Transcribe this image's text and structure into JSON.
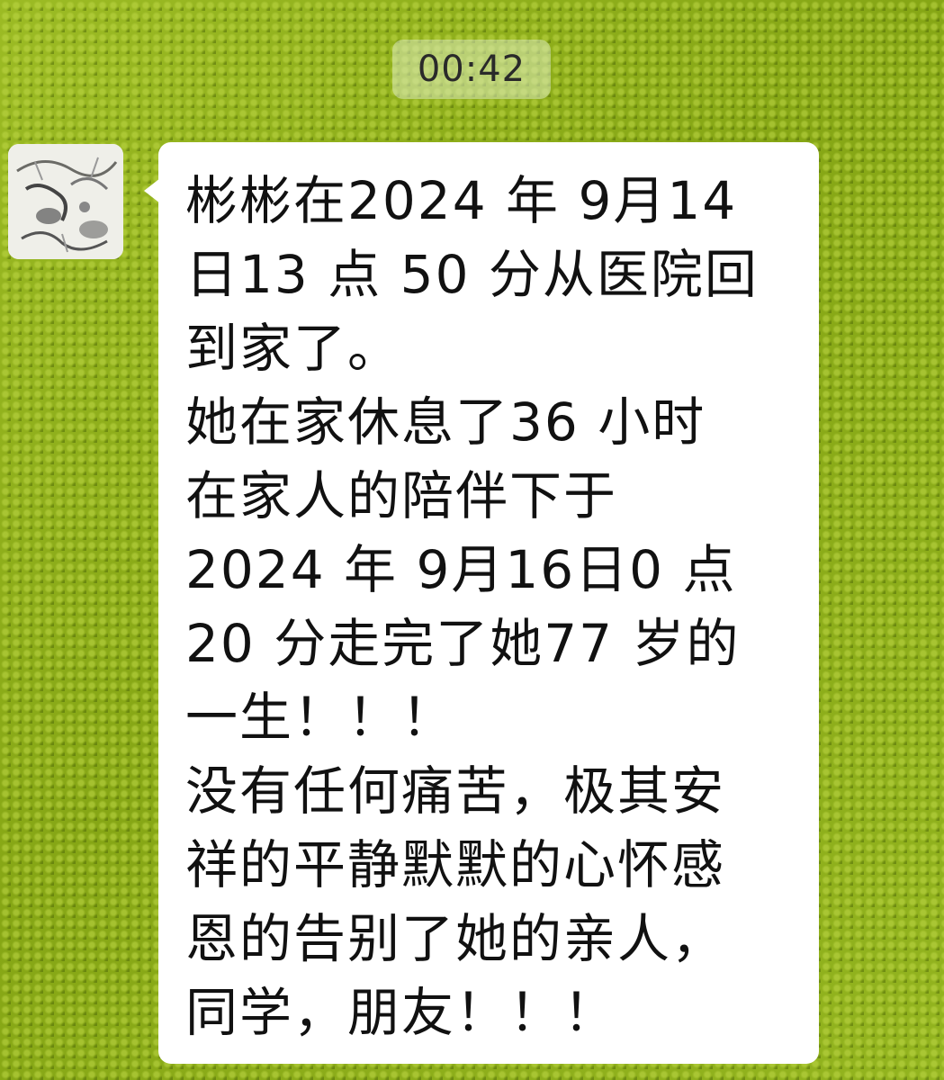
{
  "chat": {
    "timestamp": "00:42",
    "avatar_icon": "ink-painting-avatar",
    "message_lines": [
      "彬彬在2024 年 9月14",
      "日13 点 50 分从医院回",
      "到家了。",
      "她在家休息了36 小时",
      "在家人的陪伴下于",
      "2024 年 9月16日0 点",
      "20 分走完了她77 岁的",
      "一生！！！",
      "没有任何痛苦，极其安",
      "祥的平静默默的心怀感",
      "恩的告别了她的亲人，",
      "同学，朋友！！！"
    ]
  },
  "colors": {
    "background": "#8fae1c",
    "bubble": "#ffffff",
    "text": "#111111"
  }
}
